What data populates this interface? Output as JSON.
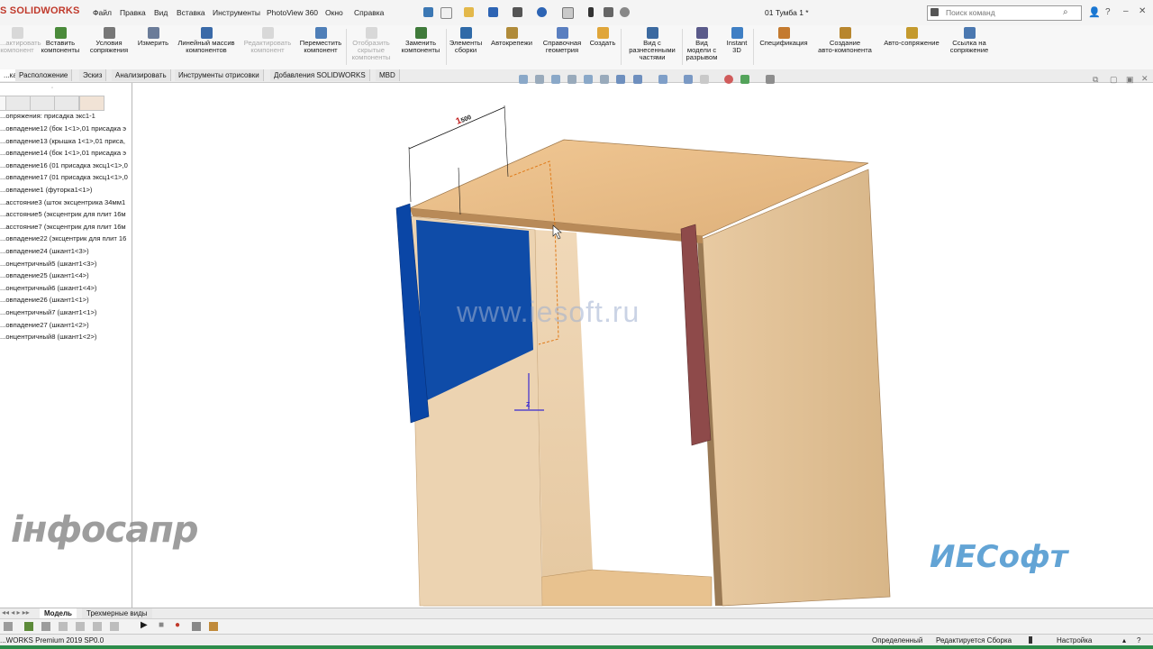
{
  "app": {
    "logo": "S SOLIDWORKS",
    "doc_title": "01 Тумба 1 *"
  },
  "menu": [
    "Файл",
    "Правка",
    "Вид",
    "Вставка",
    "Инструменты",
    "PhotoView 360",
    "Окно",
    "Справка"
  ],
  "search": {
    "placeholder": "Поиск команд"
  },
  "ribbon": {
    "items": [
      {
        "label": "...актировать\nкомпонент",
        "disabled": true
      },
      {
        "label": "Вставить\nкомпоненты",
        "disabled": false
      },
      {
        "label": "Условия\nсопряжения",
        "disabled": false
      },
      {
        "label": "Измерить",
        "disabled": false
      },
      {
        "label": "Линейный массив\nкомпонентов",
        "disabled": false
      },
      {
        "label": "Редактировать\nкомпонент",
        "disabled": true
      },
      {
        "label": "Переместить\nкомпонент",
        "disabled": false
      },
      {
        "label": "Отобразить\nскрытые\nкомпоненты",
        "disabled": true
      },
      {
        "label": "Заменить\nкомпоненты",
        "disabled": false
      },
      {
        "label": "Элементы\nсборки",
        "disabled": false
      },
      {
        "label": "Автокрепежи",
        "disabled": false
      },
      {
        "label": "Справочная\nгеометрия",
        "disabled": false
      },
      {
        "label": "Создать",
        "disabled": false
      },
      {
        "label": "Вид с\nразнесенными\nчастями",
        "disabled": false
      },
      {
        "label": "Вид\nмодели с\nразрывом",
        "disabled": false
      },
      {
        "label": "Instant\n3D",
        "disabled": false
      },
      {
        "label": "Спецификация",
        "disabled": false
      },
      {
        "label": "Создание\nавто-компонента",
        "disabled": false
      },
      {
        "label": "Авто-сопряжение",
        "disabled": false
      },
      {
        "label": "Ссылка на\nсопряжение",
        "disabled": false
      }
    ]
  },
  "command_tabs": [
    {
      "label": "...ка",
      "active": true
    },
    {
      "label": "Расположение",
      "active": false
    },
    {
      "label": "Эскиз",
      "active": false
    },
    {
      "label": "Анализировать",
      "active": false
    },
    {
      "label": "Инструменты отрисовки",
      "active": false
    },
    {
      "label": "Добавления SOLIDWORKS",
      "active": false
    },
    {
      "label": "MBD",
      "active": false
    }
  ],
  "tree": {
    "header": "...опряжения: присадка экс1-1",
    "items": [
      "...овпадение12 (бок 1<1>,01 присадка э",
      "...овпадение13 (крышка 1<1>,01 приса,",
      "...овпадение14 (бок 1<1>,01 присадка э",
      "...овпадение16 (01 присадка эксц1<1>,0",
      "...овпадение17 (01 присадка эксц1<1>,0",
      "...овпадение1 (футорка1<1>)",
      "...асстояние3 (шток эксцентрика 34мм1",
      "...асстояние5 (эксцентрик для плит 16м",
      "...асстояние7 (эксцентрик для плит 16м",
      "...овпадение22 (эксцентрик для плит 16",
      "...овпадение24 (шкант1<3>)",
      "...онцентричный5 (шкант1<3>)",
      "...овпадение25 (шкант1<4>)",
      "...онцентричный6 (шкант1<4>)",
      "...овпадение26 (шкант1<1>)",
      "...онцентричный7 (шкант1<1>)",
      "...овпадение27 (шкант1<2>)",
      "...онцентричный8 (шкант1<2>)"
    ]
  },
  "viewport": {
    "dimension_label": "1",
    "dimension_value": "500",
    "watermark": "www.iesoft.ru",
    "triad_label": "Z"
  },
  "watermarks": {
    "left": "iнфосапр",
    "right": "ИЕСофт"
  },
  "bottom_tabs": [
    {
      "label": "Модель",
      "active": true
    },
    {
      "label": "Трехмерные виды",
      "active": false
    }
  ],
  "status": {
    "version": "...WORKS Premium 2019 SP0.0",
    "state": "Определенный",
    "mode": "Редактируется Сборка",
    "settings": "Настройка"
  }
}
